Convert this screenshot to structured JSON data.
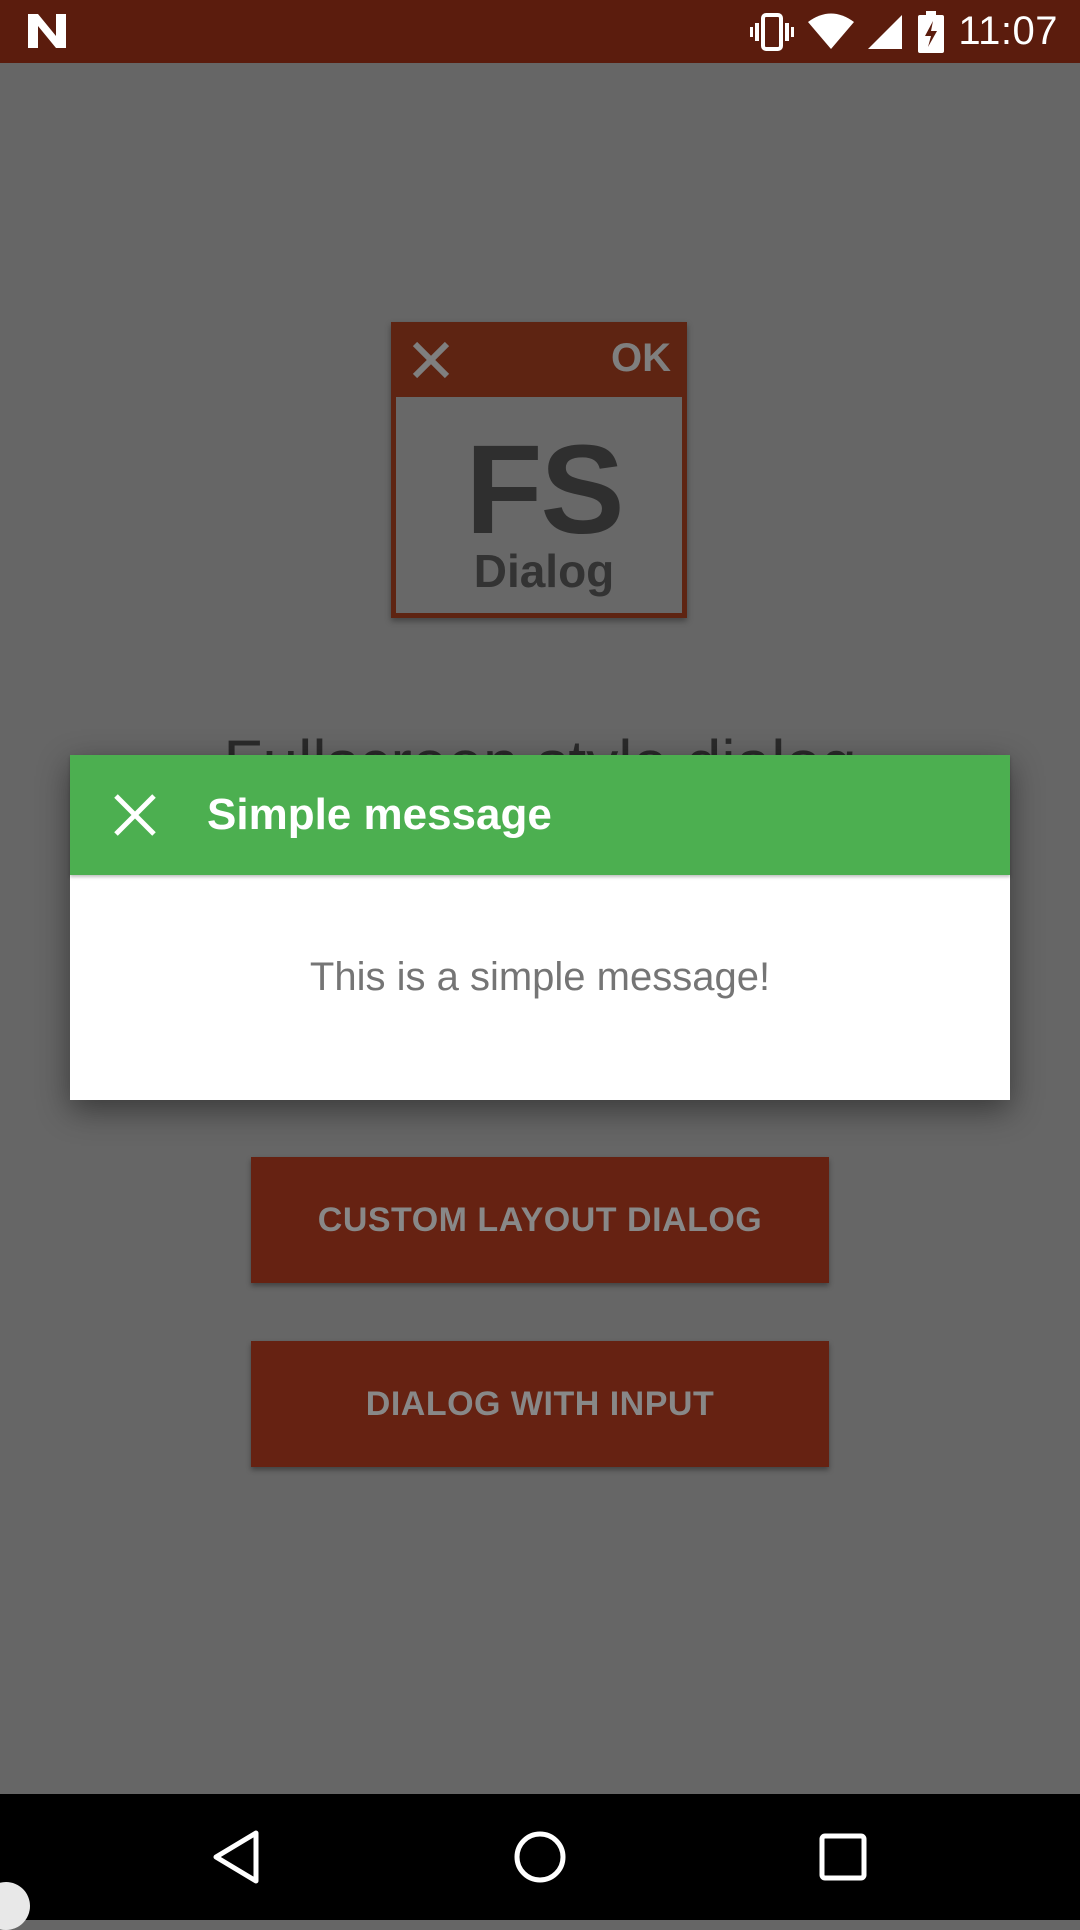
{
  "status_bar": {
    "time": "11:07",
    "icons": [
      "n-logo-icon",
      "vibrate-icon",
      "wifi-icon",
      "signal-icon",
      "battery-charging-icon"
    ]
  },
  "app": {
    "logo": {
      "close_icon": "close-icon",
      "ok_label": "OK",
      "big_text": "FS",
      "sub_text": "Dialog"
    },
    "title_partially_hidden": "Fullscreen style dialog",
    "buttons": [
      {
        "label": "CUSTOM LAYOUT DIALOG"
      },
      {
        "label": "DIALOG WITH INPUT"
      }
    ],
    "colors": {
      "primary_dark": "#5b1c0d",
      "button": "#662212",
      "scrim_bg": "#666666"
    }
  },
  "dialog": {
    "title": "Simple message",
    "close_icon": "close-icon",
    "message": "This is a simple message!",
    "header_color": "#4caf50"
  },
  "nav_bar": {
    "buttons": [
      "back-icon",
      "home-icon",
      "recents-icon"
    ]
  }
}
